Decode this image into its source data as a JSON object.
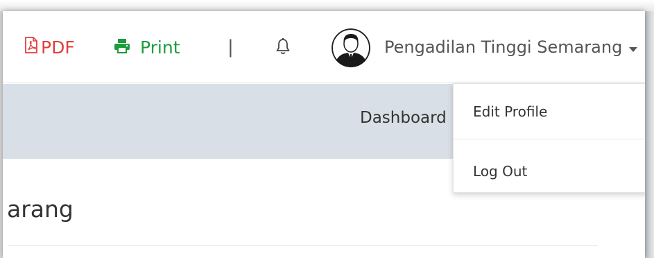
{
  "colors": {
    "pdf": "#e0403b",
    "print": "#1e9b3f",
    "nav_band": "#d9dfe6",
    "text": "#555555"
  },
  "toolbar": {
    "pdf_label": "PDF",
    "print_label": "Print",
    "separator": "|",
    "pdf_icon": "pdf-file-icon",
    "print_icon": "printer-icon",
    "bell_icon": "bell-icon"
  },
  "user": {
    "name": "Pengadilan Tinggi Semarang",
    "caret": "▾",
    "avatar_icon": "user-avatar-icon"
  },
  "nav": {
    "dashboard_label": "Dashboard"
  },
  "page": {
    "title_fragment": "arang"
  },
  "user_menu": {
    "items": [
      {
        "label": "Edit Profile"
      },
      {
        "label": "Log Out"
      }
    ]
  }
}
